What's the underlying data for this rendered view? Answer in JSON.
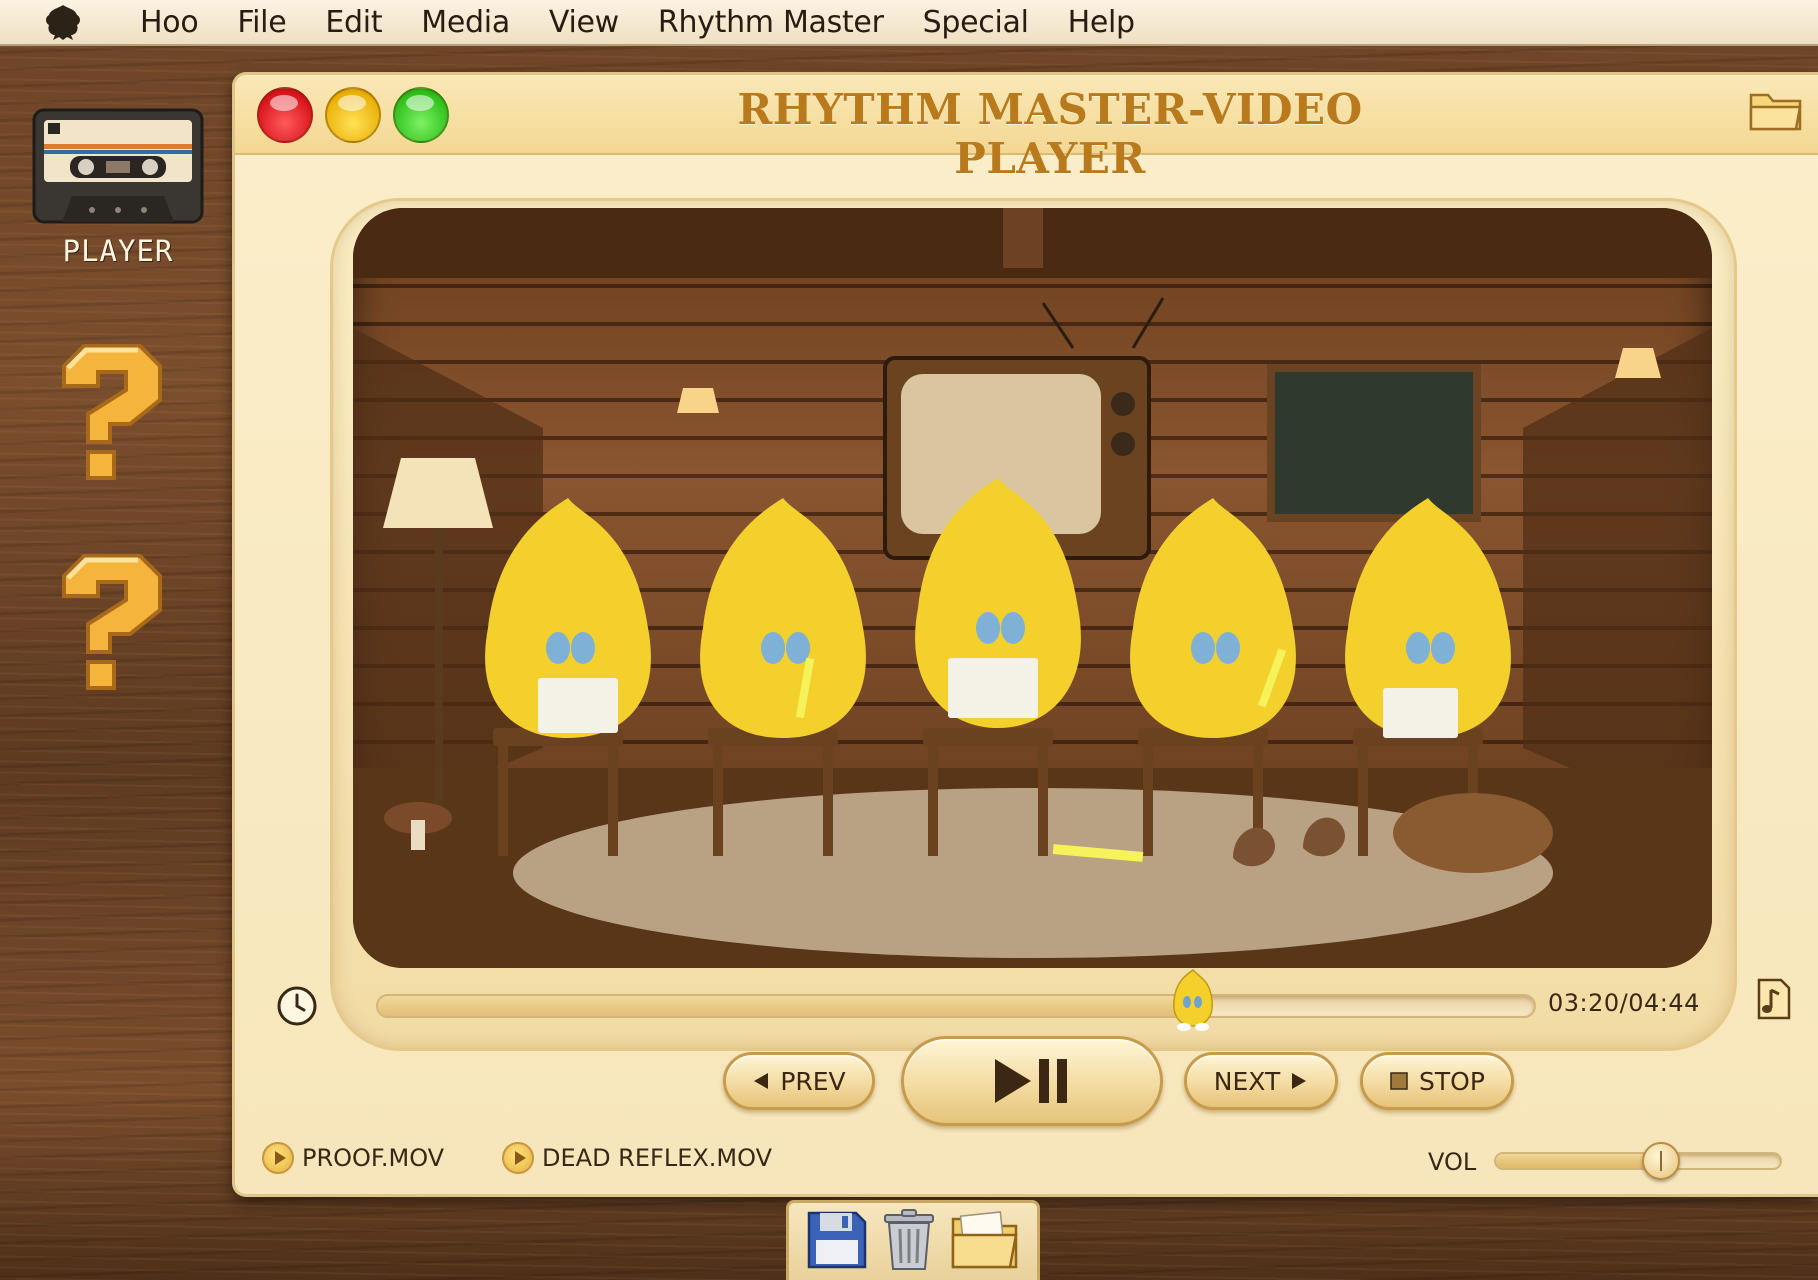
{
  "menubar": {
    "logo_icon": "mascot-logo-icon",
    "items": [
      "Hoo",
      "File",
      "Edit",
      "Media",
      "View",
      "Rhythm Master",
      "Special",
      "Help"
    ]
  },
  "desktop": {
    "player": {
      "label": "PLAYER",
      "icon": "cassette-tape-icon"
    },
    "unknown_icons": [
      "question-mark-icon",
      "question-mark-icon"
    ]
  },
  "window": {
    "title": "RHYTHM MASTER-VIDEO PLAYER",
    "controls": [
      "close",
      "minimize",
      "maximize"
    ],
    "corner_icon": "folder-icon"
  },
  "playback": {
    "time": "03:20/04:44",
    "elapsed_seconds": 200,
    "total_seconds": 284,
    "thumb_icon": "mascot-thumb-icon",
    "clock_icon": "clock-icon",
    "music_icon": "music-note-icon"
  },
  "buttons": {
    "prev": "PREV",
    "next": "NEXT",
    "stop": "STOP",
    "play_pause_icon": "play-pause-icon"
  },
  "files": [
    "PROOF.MOV",
    "DEAD REFLEX.MOV"
  ],
  "volume": {
    "label": "VOL",
    "level": 0.58
  },
  "dock": {
    "icons": [
      "floppy-disk-icon",
      "trash-can-icon",
      "folder-icon"
    ]
  },
  "colors": {
    "accent": "#b87a1c",
    "window_bg": "#f7e6bb",
    "close": "#d8141c",
    "minimize": "#eab008",
    "maximize": "#2fbf1a"
  }
}
